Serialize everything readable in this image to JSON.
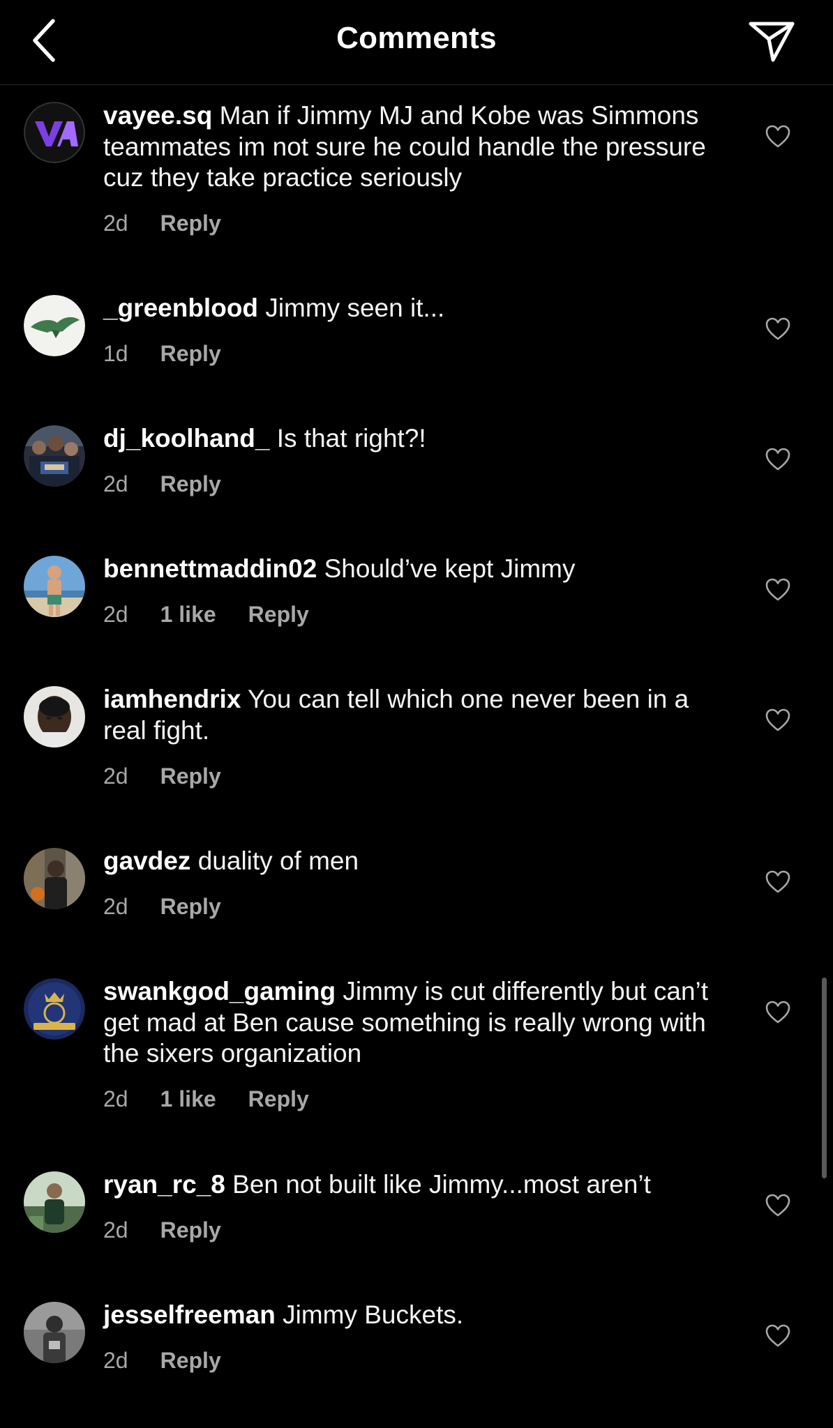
{
  "header": {
    "title": "Comments",
    "back_icon": "chevron-left-icon",
    "share_icon": "paper-plane-icon"
  },
  "colors": {
    "background": "#000000",
    "text": "#ffffff",
    "meta": "#a8a8a8"
  },
  "comments": [
    {
      "username": "vayee.sq",
      "text": "Man if Jimmy MJ and Kobe was Simmons teammates im not sure he could handle the pressure cuz they take practice seriously",
      "time": "2d",
      "likes": "",
      "reply": "Reply"
    },
    {
      "username": "_greenblood",
      "text": "Jimmy seen it...",
      "time": "1d",
      "likes": "",
      "reply": "Reply"
    },
    {
      "username": "dj_koolhand_",
      "text": "Is that right?!",
      "time": "2d",
      "likes": "",
      "reply": "Reply"
    },
    {
      "username": "bennettmaddin02",
      "text": "Should’ve kept Jimmy",
      "time": "2d",
      "likes": "1 like",
      "reply": "Reply"
    },
    {
      "username": "iamhendrix",
      "text": "You can tell which one never been in a real fight.",
      "time": "2d",
      "likes": "",
      "reply": "Reply"
    },
    {
      "username": "gavdez",
      "text": "duality of men",
      "time": "2d",
      "likes": "",
      "reply": "Reply"
    },
    {
      "username": "swankgod_gaming",
      "text": "Jimmy is cut differently but can’t get mad at Ben cause something is really wrong with the sixers organization",
      "time": "2d",
      "likes": "1 like",
      "reply": "Reply"
    },
    {
      "username": "ryan_rc_8",
      "text": "Ben not built like Jimmy...most aren’t",
      "time": "2d",
      "likes": "",
      "reply": "Reply"
    },
    {
      "username": "jesselfreeman",
      "text": "Jimmy Buckets.",
      "time": "2d",
      "likes": "",
      "reply": "Reply"
    }
  ]
}
